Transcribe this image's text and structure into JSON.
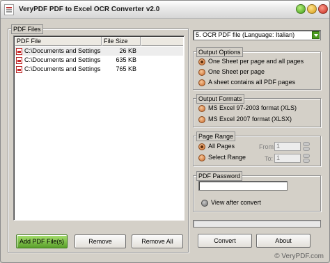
{
  "window": {
    "title": "VeryPDF PDF to Excel OCR Converter v2.0"
  },
  "pdf_files": {
    "group_label": "PDF Files",
    "columns": [
      "PDF File",
      "File Size"
    ],
    "rows": [
      {
        "file": "C:\\Documents and Settings...",
        "size": "26 KB"
      },
      {
        "file": "C:\\Documents and Settings...",
        "size": "635 KB"
      },
      {
        "file": "C:\\Documents and Settings...",
        "size": "765 KB"
      }
    ],
    "add_label": "Add PDF File(s)",
    "remove_label": "Remove",
    "remove_all_label": "Remove All"
  },
  "ocr_mode": {
    "selected": "5. OCR PDF file (Language: Italian)"
  },
  "output_options": {
    "label": "Output Options",
    "options": [
      {
        "label": "One Sheet per page and all pages",
        "checked": true
      },
      {
        "label": "One Sheet per page",
        "checked": false
      },
      {
        "label": "A sheet contains all PDF pages",
        "checked": false
      }
    ]
  },
  "output_formats": {
    "label": "Output Formats",
    "options": [
      {
        "label": "MS Excel 97-2003 format (XLS)",
        "checked": false
      },
      {
        "label": "MS Excel 2007 format (XLSX)",
        "checked": false
      }
    ]
  },
  "page_range": {
    "label": "Page Range",
    "all_pages_label": "All Pages",
    "select_range_label": "Select Range",
    "from_label": "From:",
    "to_label": "To:",
    "from_value": "1",
    "to_value": "1"
  },
  "pdf_password": {
    "label": "PDF Password",
    "value": ""
  },
  "view_after_convert": {
    "label": "View after convert"
  },
  "progress": {
    "fraction": 0
  },
  "actions": {
    "convert_label": "Convert",
    "about_label": "About"
  },
  "brand": "© VeryPDF.com",
  "colors": {
    "window_bg": "#d4d0c8",
    "accent_green": "#4a9a1e",
    "radio_orange": "#c8682a"
  }
}
